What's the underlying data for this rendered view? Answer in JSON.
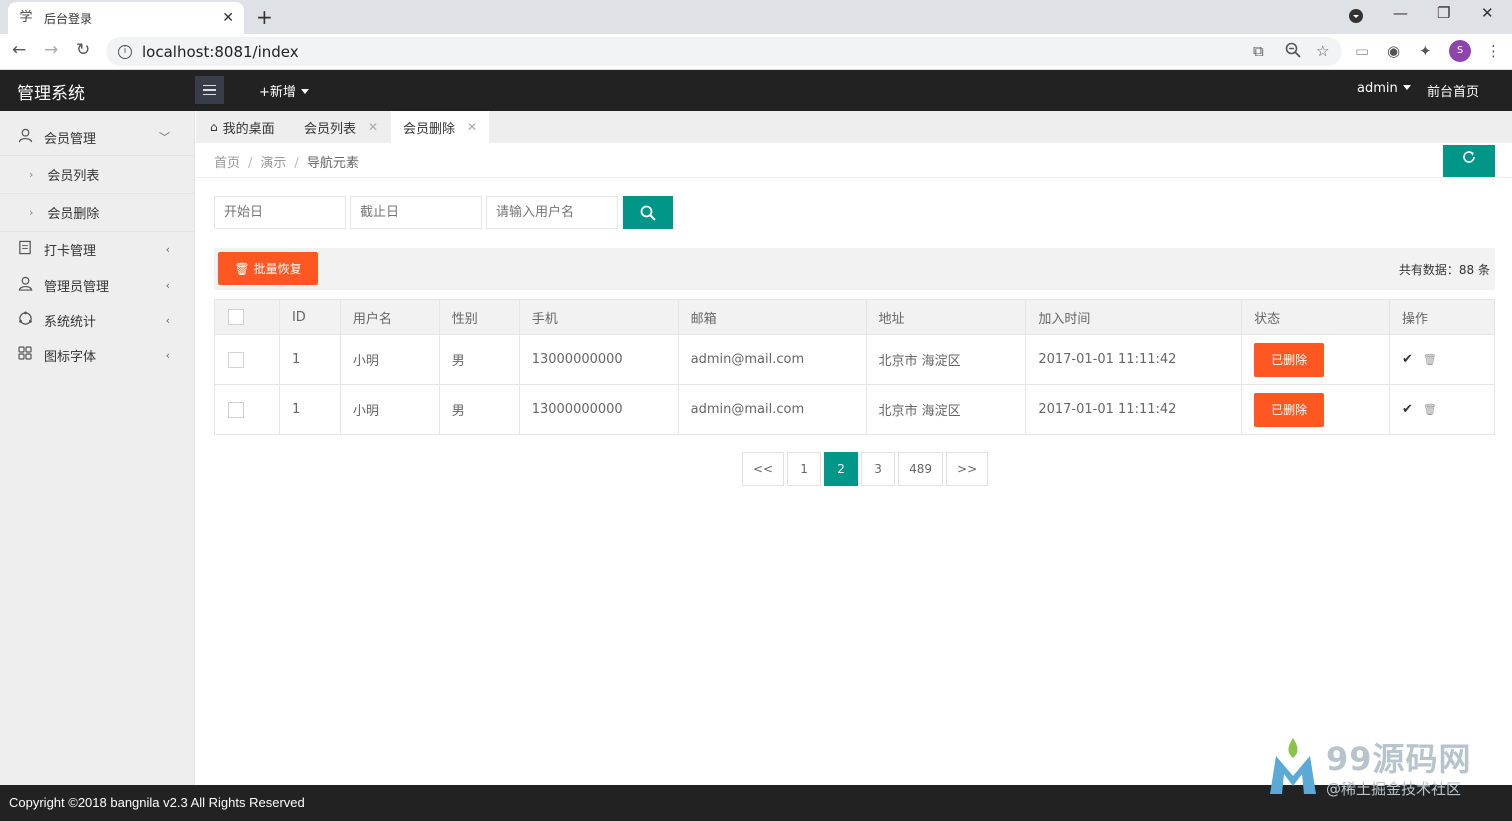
{
  "browser": {
    "tab_title": "后台登录",
    "favicon": "学",
    "url": "localhost:8081/index",
    "profile_initial": "S"
  },
  "header": {
    "logo": "管理系统",
    "add_new": "+新增",
    "user": "admin",
    "frontend_link": "前台首页"
  },
  "sidebar": {
    "items": [
      {
        "label": "会员管理",
        "icon": "user-icon"
      },
      {
        "label": "打卡管理",
        "icon": "clipboard-icon"
      },
      {
        "label": "管理员管理",
        "icon": "admin-icon"
      },
      {
        "label": "系统统计",
        "icon": "stats-icon"
      },
      {
        "label": "图标字体",
        "icon": "grid-icon"
      }
    ],
    "sub_items": [
      {
        "label": "会员列表"
      },
      {
        "label": "会员删除"
      }
    ]
  },
  "page_tabs": [
    {
      "label": "我的桌面"
    },
    {
      "label": "会员列表"
    },
    {
      "label": "会员删除"
    }
  ],
  "breadcrumb": {
    "home": "首页",
    "demo": "演示",
    "current": "导航元素"
  },
  "search": {
    "start_placeholder": "开始日",
    "end_placeholder": "截止日",
    "username_placeholder": "请输入用户名"
  },
  "actions": {
    "batch_restore": "批量恢复",
    "total_text": "共有数据：88 条"
  },
  "table": {
    "headers": [
      "ID",
      "用户名",
      "性别",
      "手机",
      "邮箱",
      "地址",
      "加入时间",
      "状态",
      "操作"
    ],
    "rows": [
      {
        "id": "1",
        "username": "小明",
        "gender": "男",
        "phone": "13000000000",
        "email": "admin@mail.com",
        "address": "北京市 海淀区",
        "joined": "2017-01-01 11:11:42",
        "status": "已删除"
      },
      {
        "id": "1",
        "username": "小明",
        "gender": "男",
        "phone": "13000000000",
        "email": "admin@mail.com",
        "address": "北京市 海淀区",
        "joined": "2017-01-01 11:11:42",
        "status": "已删除"
      }
    ]
  },
  "pagination": {
    "prev": "<<",
    "pages": [
      "1",
      "2",
      "3",
      "489"
    ],
    "current": "2",
    "next": ">>"
  },
  "footer": {
    "copyright": "Copyright ©2018 bangnila v2.3 All Rights Reserved"
  },
  "watermark": {
    "brand": "99源码网",
    "sub": "@稀土掘金技术社区"
  },
  "colors": {
    "primary": "#009688",
    "danger": "#ff5722",
    "header_bg": "#222222"
  }
}
